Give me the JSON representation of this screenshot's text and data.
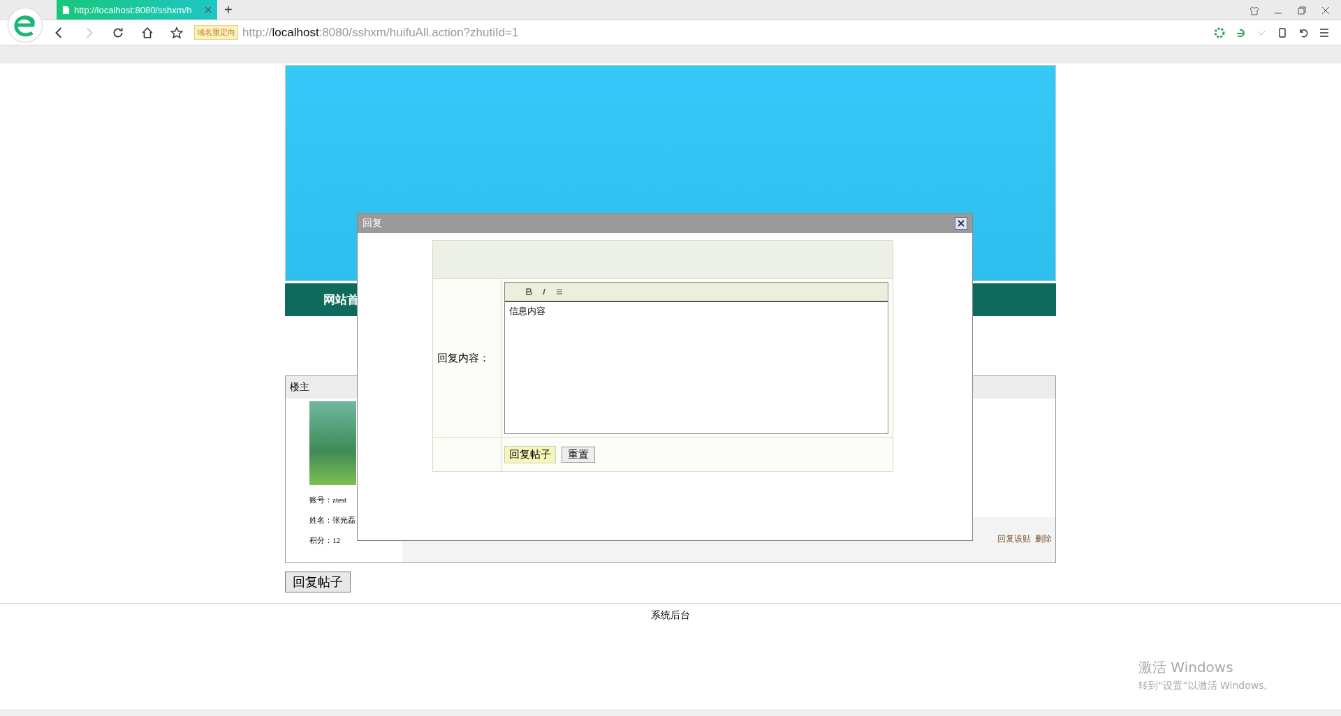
{
  "browser": {
    "tabs": [
      {
        "title": "http://localhost:8080/sshxm/h",
        "selected": true
      }
    ],
    "new_tab": "+",
    "redirect_badge": "域名重定向",
    "url_parts": [
      {
        "text": "http://",
        "emphasis": false
      },
      {
        "text": "localhost",
        "emphasis": true
      },
      {
        "text": ":8080/sshxm/huifuAll.action?zhutiId=1",
        "emphasis": false
      }
    ]
  },
  "nav": {
    "items": [
      "网站首"
    ]
  },
  "post": {
    "header": "楼主",
    "author_fields": [
      "账号：ztest",
      "姓名：张光磊",
      "积分：12"
    ],
    "actions": [
      "回复该贴",
      "删除"
    ]
  },
  "reply_button": "回复帖子",
  "footer": "系统后台",
  "dialog": {
    "title": "回复",
    "form": {
      "label": "回复内容：",
      "editor_text": "信息内容",
      "submit": "回复帖子",
      "reset": "重置"
    }
  },
  "os_notice": {
    "title": "激活 Windows",
    "subtitle": "转到“设置”以激活 Windows。"
  }
}
